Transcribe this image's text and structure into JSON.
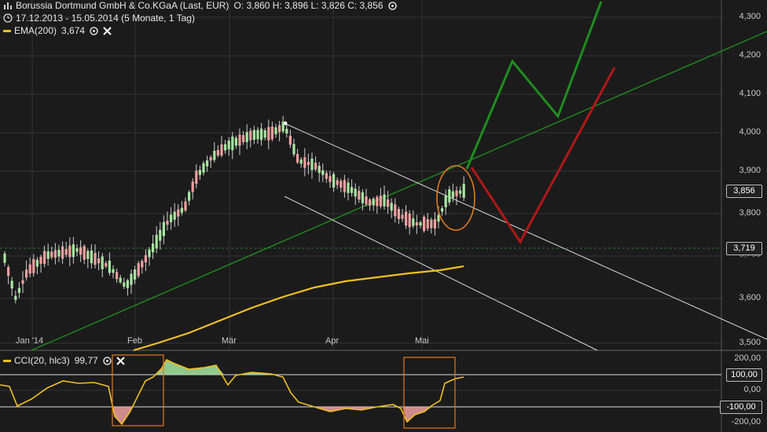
{
  "instrument": {
    "name": "Borussia Dortmund GmbH & Co.KGaA (Last, EUR)",
    "ohlc": "O: 3,860  H: 3,896  L: 3,826  C: 3,856",
    "range": "17.12.2013 - 15.05.2014 (5 Monate, 1 Tag)"
  },
  "ema": {
    "label": "EMA(200)",
    "value": "3,674",
    "color": "#f0c020"
  },
  "cci": {
    "label": "CCI(20, hlc3)",
    "value": "99,77"
  },
  "price_axis": {
    "ticks": [
      "4,300",
      "4,200",
      "4,100",
      "4,000",
      "3,900",
      "3,800",
      "3,700",
      "3,600",
      "3,500"
    ],
    "last_tag": "3,856",
    "line_tag": "3,719"
  },
  "cci_axis": {
    "ticks": [
      "200,00",
      "100,00",
      "0,00",
      "-100,00",
      "-200,00"
    ]
  },
  "time_axis": [
    "Jan '14",
    "Feb",
    "Mär",
    "Apr",
    "Mai"
  ],
  "colors": {
    "up": "#a6e6a0",
    "down": "#f0a0a0",
    "trend_green": "#1f8a1f",
    "arrow_red": "#b01818",
    "arrow_green": "#1e8c1e",
    "ellipse": "#e07a1c"
  },
  "icons": [
    "chart-icon",
    "clock-icon",
    "settings-circle-icon",
    "close-icon"
  ]
}
